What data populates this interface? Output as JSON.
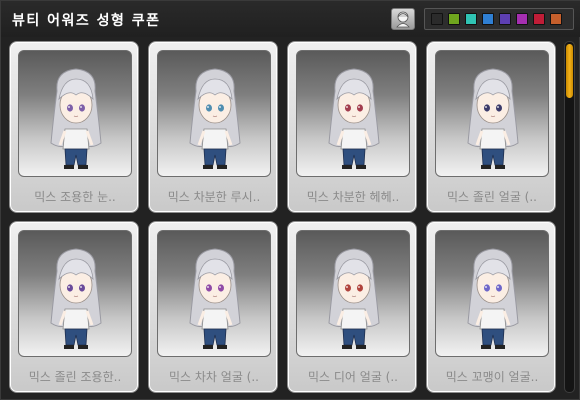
{
  "header": {
    "title": "뷰티 어워즈 성형 쿠폰",
    "palette_colors": [
      "#2b2b2b",
      "#6fa61e",
      "#30c4b4",
      "#2f7fd3",
      "#5d3fb2",
      "#a52fb0",
      "#c01d37",
      "#c55f2c"
    ]
  },
  "coupons": [
    {
      "label": "믹스 조용한 눈..",
      "eye_color": "#7d5fa8"
    },
    {
      "label": "믹스 차분한 루시..",
      "eye_color": "#4f8db0"
    },
    {
      "label": "믹스 차분한 헤헤..",
      "eye_color": "#a23c4e"
    },
    {
      "label": "믹스 졸린 얼굴 (..",
      "eye_color": "#3a3a6a"
    },
    {
      "label": "믹스 졸린 조용한..",
      "eye_color": "#6a4a9a"
    },
    {
      "label": "믹스 차차 얼굴 (..",
      "eye_color": "#8f4aa6"
    },
    {
      "label": "믹스 디어 얼굴 (..",
      "eye_color": "#b0433d"
    },
    {
      "label": "믹스 꼬맹이 얼굴..",
      "eye_color": "#6d66c9"
    }
  ],
  "scroll": {
    "position": 0.0
  }
}
